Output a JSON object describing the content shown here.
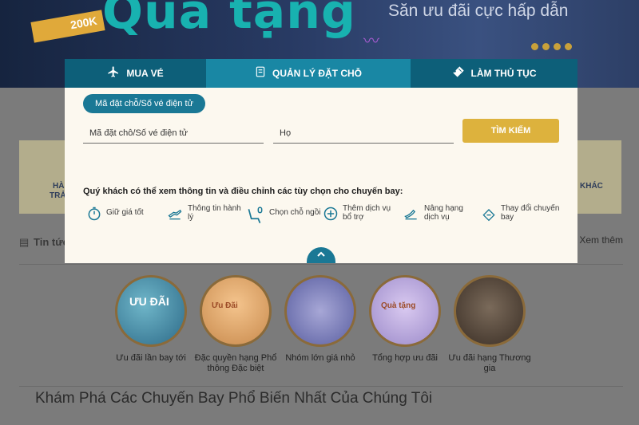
{
  "hero": {
    "title": "Quà tặng",
    "badge": "200K",
    "tagline": "Săn ưu đãi cực hấp dẫn"
  },
  "modal": {
    "tabs": [
      {
        "label": "MUA VÉ",
        "icon": "plane-icon"
      },
      {
        "label": "QUẢN LÝ ĐẶT CHỖ",
        "icon": "booking-icon"
      },
      {
        "label": "LÀM THỦ TỤC",
        "icon": "ticket-icon"
      }
    ],
    "active_tab": "QUẢN LÝ ĐẶT CHỖ",
    "option_pill": "Mã đặt chỗ/Số vé điện tử",
    "booking_code_placeholder": "Mã đặt chỗ/Số vé điện tử",
    "lastname_placeholder": "Họ",
    "search_button": "TÌM KIẾM",
    "info_text": "Quý khách có thể xem thông tin và điều chỉnh các tùy chọn cho chuyến bay:",
    "services": [
      {
        "label": "Giữ giá tốt",
        "icon": "stopwatch-icon"
      },
      {
        "label": "Thông tin hành lý",
        "icon": "baggage-icon"
      },
      {
        "label": "Chọn chỗ ngồi",
        "icon": "seat-icon"
      },
      {
        "label": "Thêm dịch vụ bổ trợ",
        "icon": "plus-circle-icon"
      },
      {
        "label": "Nâng hạng dịch vụ",
        "icon": "upgrade-icon"
      },
      {
        "label": "Thay đổi chuyến bay",
        "icon": "change-ticket-icon"
      }
    ],
    "accent_color": "#1a7895",
    "button_color": "#ddb23d"
  },
  "background": {
    "card_left_line1": "HÀ",
    "card_left_line2": "TRẢ",
    "card_right_text": "KHÁC",
    "news_title": "Tin tức",
    "news_more": "Xem thêm",
    "promos": [
      {
        "label": "Ưu đãi lần bay tới",
        "circle_text": "ƯU ĐÃI"
      },
      {
        "label": "Đặc quyền hạng Phổ thông Đặc biệt",
        "circle_text": "Ưu Đãi"
      },
      {
        "label": "Nhóm lớn giá nhỏ",
        "circle_text": ""
      },
      {
        "label": "Tổng hợp ưu đãi",
        "circle_text": "Quà tặng"
      },
      {
        "label": "Ưu đãi hạng Thương gia",
        "circle_text": ""
      }
    ],
    "explore_heading": "Khám Phá Các Chuyến Bay Phổ Biến Nhất Của Chúng Tôi"
  }
}
